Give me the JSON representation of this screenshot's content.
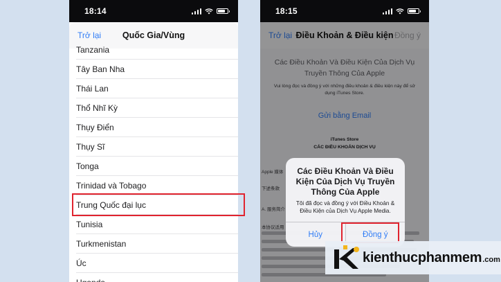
{
  "left_phone": {
    "status": {
      "time": "18:14"
    },
    "nav": {
      "back_label": "Trở lại",
      "title": "Quốc Gia/Vùng"
    },
    "countries": [
      "Tanzania",
      "Tây Ban Nha",
      "Thái Lan",
      "Thổ Nhĩ Kỳ",
      "Thụy Điển",
      "Thụy Sĩ",
      "Tonga",
      "Trinidad và Tobago",
      "Trung Quốc đại lục",
      "Tunisia",
      "Turkmenistan",
      "Úc",
      "Uganda"
    ],
    "selected_country": "Trung Quốc đại lục"
  },
  "right_phone": {
    "status": {
      "time": "18:15"
    },
    "nav": {
      "back_label": "Trở lại",
      "title": "Điều Khoản & Điều kiện",
      "agree_label": "Đồng ý"
    },
    "terms": {
      "heading": "Các Điều Khoản Và Điều Kiện Của Dịch Vụ Truyền Thông Của Apple",
      "description": "Vui lòng đọc và đồng ý với những điều khoản & điều kiện này để sử dụng iTunes Store.",
      "email_link": "Gửi bằng Email",
      "store_name": "iTunes Store",
      "store_subtitle": "CÁC ĐIỀU KHOẢN DỊCH VỤ",
      "body_labels": [
        "Apple 媒体",
        "下述条款",
        "A. 服务简介",
        "本协议适用"
      ]
    },
    "alert": {
      "title": "Các Điều Khoản Và Điều Kiện Của Dịch Vụ Truyền Thông Của Apple",
      "message": "Tôi đã đọc và đồng ý với Điều Khoản & Điều Kiện của Dịch Vụ Apple Media.",
      "cancel_label": "Hủy",
      "agree_label": "Đồng ý"
    }
  },
  "watermark": {
    "main": "kienthucphanmem",
    "domain": ".com"
  },
  "colors": {
    "background": "#d3e0ef",
    "ios_blue": "#2f7cf6",
    "highlight_red": "#e0232e",
    "status_bar": "#0b0b0d"
  }
}
